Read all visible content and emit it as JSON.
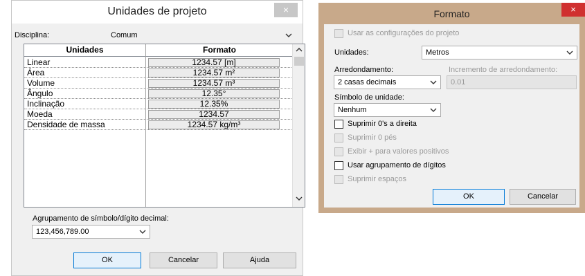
{
  "left_dialog": {
    "title": "Unidades de projeto",
    "close_label": "×",
    "disciplina_label": "Disciplina:",
    "disciplina_value": "Comum",
    "table": {
      "headers": [
        "Unidades",
        "Formato"
      ],
      "rows": [
        {
          "unit": "Linear",
          "format": "1234.57 [m]"
        },
        {
          "unit": "Área",
          "format": "1234.57 m²"
        },
        {
          "unit": "Volume",
          "format": "1234.57 m³"
        },
        {
          "unit": "Ângulo",
          "format": "12.35°"
        },
        {
          "unit": "Inclinação",
          "format": "12.35%"
        },
        {
          "unit": "Moeda",
          "format": "1234.57"
        },
        {
          "unit": "Densidade de massa",
          "format": "1234.57 kg/m³"
        }
      ]
    },
    "grouping_label": "Agrupamento de símbolo/dígito decimal:",
    "grouping_value": "123,456,789.00",
    "ok_label": "OK",
    "cancel_label": "Cancelar",
    "help_label": "Ajuda"
  },
  "right_dialog": {
    "title": "Formato",
    "close_label": "×",
    "use_project_settings": "Usar as configurações do projeto",
    "unidades_label": "Unidades:",
    "unidades_value": "Metros",
    "arredondamento_label": "Arredondamento:",
    "arredondamento_value": "2 casas decimais",
    "incremento_label": "Incremento de arredondamento:",
    "incremento_value": "0.01",
    "simbolo_label": "Símbolo de unidade:",
    "simbolo_value": "Nenhum",
    "suprimir_direita": "Suprimir 0's a direita",
    "suprimir_pes": "Suprimir 0 pés",
    "exibir_positivos": "Exibir + para valores positivos",
    "usar_agrupamento": "Usar agrupamento de dígitos",
    "suprimir_espacos": "Suprimir espaços",
    "ok_label": "OK",
    "cancel_label": "Cancelar"
  },
  "colors": {
    "dialog_bg": "#f0f0f0",
    "right_frame": "#c8a98a",
    "close_red": "#d0302f",
    "default_button_border": "#0078d7"
  }
}
